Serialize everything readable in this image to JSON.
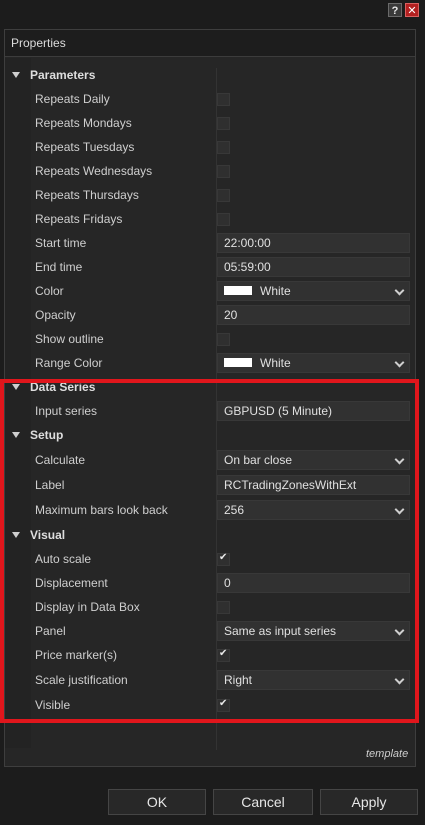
{
  "titlebar": {
    "help_glyph": "?",
    "close_glyph": "✕"
  },
  "panel": {
    "title": "Properties"
  },
  "sections": {
    "parameters": {
      "title": "Parameters",
      "repeats_daily": "Repeats Daily",
      "repeats_mondays": "Repeats Mondays",
      "repeats_tuesdays": "Repeats Tuesdays",
      "repeats_wednesdays": "Repeats Wednesdays",
      "repeats_thursdays": "Repeats Thursdays",
      "repeats_fridays": "Repeats Fridays",
      "start_time_label": "Start time",
      "start_time_value": "22:00:00",
      "end_time_label": "End time",
      "end_time_value": "05:59:00",
      "color_label": "Color",
      "color_value": "White",
      "opacity_label": "Opacity",
      "opacity_value": "20",
      "show_outline_label": "Show outline",
      "range_color_label": "Range Color",
      "range_color_value": "White"
    },
    "data_series": {
      "title": "Data Series",
      "input_series_label": "Input series",
      "input_series_value": "GBPUSD (5 Minute)"
    },
    "setup": {
      "title": "Setup",
      "calculate_label": "Calculate",
      "calculate_value": "On bar close",
      "label_label": "Label",
      "label_value": "RCTradingZonesWithExt",
      "max_bars_label": "Maximum bars look back",
      "max_bars_value": "256"
    },
    "visual": {
      "title": "Visual",
      "auto_scale_label": "Auto scale",
      "displacement_label": "Displacement",
      "displacement_value": "0",
      "display_in_data_box_label": "Display in Data Box",
      "panel_label": "Panel",
      "panel_value": "Same as input series",
      "price_markers_label": "Price marker(s)",
      "scale_justification_label": "Scale justification",
      "scale_justification_value": "Right",
      "visible_label": "Visible"
    }
  },
  "checkboxes": {
    "repeats_daily": false,
    "repeats_mondays": false,
    "repeats_tuesdays": false,
    "repeats_wednesdays": false,
    "repeats_thursdays": false,
    "repeats_fridays": false,
    "show_outline": false,
    "auto_scale": true,
    "display_in_data_box": false,
    "price_markers": true,
    "visible": true
  },
  "footer": {
    "template_link": "template"
  },
  "buttons": {
    "ok": "OK",
    "cancel": "Cancel",
    "apply": "Apply"
  },
  "colors": {
    "highlight": "#e0161c",
    "swatch_white": "#ffffff"
  }
}
